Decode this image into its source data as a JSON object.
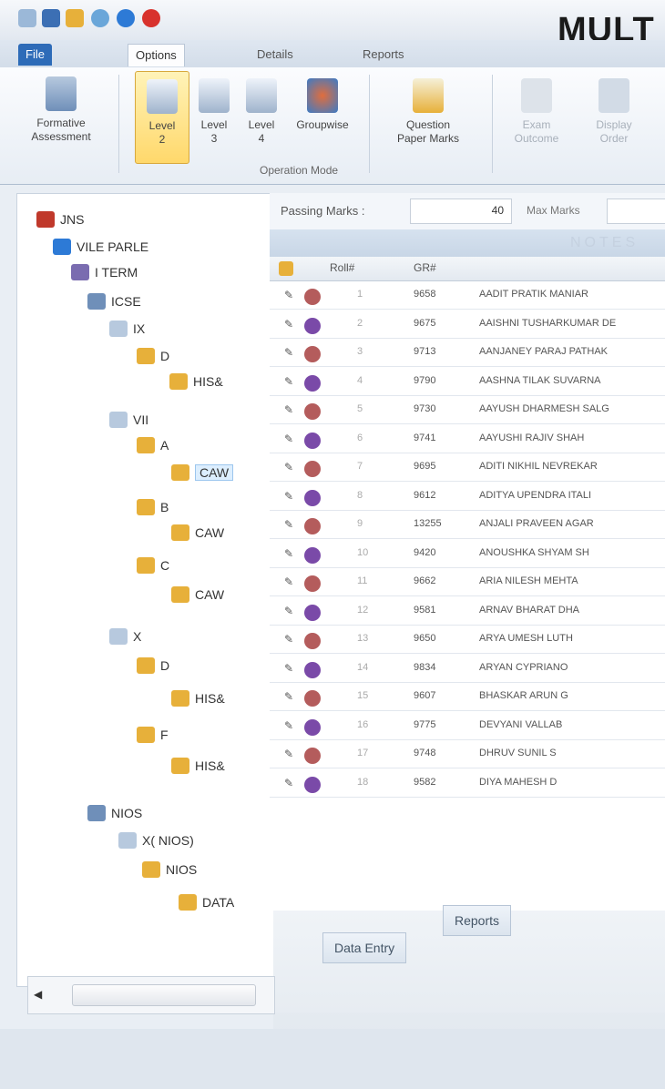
{
  "brand_heading": "MULT",
  "tabs": [
    "File",
    "Options",
    "Details",
    "Reports"
  ],
  "ribbon": {
    "formative": "Formative\nAssessment",
    "level2": "Level\n2",
    "level3": "Level\n3",
    "level4": "Level\n4",
    "groupwise": "Groupwise",
    "question_paper": "Question\nPaper Marks",
    "exam_outcome": "Exam\nOutcome",
    "display_order": "Display\nOrder",
    "group_label": "Operation Mode"
  },
  "tree": [
    {
      "label": "JNS"
    },
    {
      "label": "VILE PARLE"
    },
    {
      "label": "I TERM"
    },
    {
      "label": "ICSE"
    },
    {
      "label": "IX"
    },
    {
      "label": "D"
    },
    {
      "label": "HIS&"
    },
    {
      "label": "VII"
    },
    {
      "label": "A"
    },
    {
      "label": "CAW"
    },
    {
      "label": "B"
    },
    {
      "label": "CAW"
    },
    {
      "label": "C"
    },
    {
      "label": "CAW"
    },
    {
      "label": "X"
    },
    {
      "label": "D"
    },
    {
      "label": "HIS&"
    },
    {
      "label": "F"
    },
    {
      "label": "HIS&"
    },
    {
      "label": "NIOS"
    },
    {
      "label": "X( NIOS)"
    },
    {
      "label": "NIOS"
    },
    {
      "label": "DATA"
    }
  ],
  "passing": {
    "label": "Passing Marks :",
    "value": "40",
    "max_label": "Max Marks"
  },
  "note_text": "NOTES",
  "columns": [
    "Roll#",
    "GR#"
  ],
  "rows": [
    {
      "roll": "1",
      "gr": "9658",
      "name": "AADIT PRATIK MANIAR"
    },
    {
      "roll": "2",
      "gr": "9675",
      "name": "AAISHNI TUSHARKUMAR DE"
    },
    {
      "roll": "3",
      "gr": "9713",
      "name": "AANJANEY PARAJ PATHAK"
    },
    {
      "roll": "4",
      "gr": "9790",
      "name": "AASHNA TILAK SUVARNA"
    },
    {
      "roll": "5",
      "gr": "9730",
      "name": "AAYUSH DHARMESH SALG"
    },
    {
      "roll": "6",
      "gr": "9741",
      "name": "AAYUSHI RAJIV SHAH"
    },
    {
      "roll": "7",
      "gr": "9695",
      "name": "ADITI NIKHIL NEVREKAR"
    },
    {
      "roll": "8",
      "gr": "9612",
      "name": "ADITYA UPENDRA ITALI"
    },
    {
      "roll": "9",
      "gr": "13255",
      "name": "ANJALI PRAVEEN AGAR"
    },
    {
      "roll": "10",
      "gr": "9420",
      "name": "ANOUSHKA SHYAM SH"
    },
    {
      "roll": "11",
      "gr": "9662",
      "name": "ARIA NILESH MEHTA"
    },
    {
      "roll": "12",
      "gr": "9581",
      "name": "ARNAV BHARAT DHA"
    },
    {
      "roll": "13",
      "gr": "9650",
      "name": "ARYA UMESH LUTH"
    },
    {
      "roll": "14",
      "gr": "9834",
      "name": "ARYAN CYPRIANO"
    },
    {
      "roll": "15",
      "gr": "9607",
      "name": "BHASKAR ARUN G"
    },
    {
      "roll": "16",
      "gr": "9775",
      "name": "DEVYANI VALLAB"
    },
    {
      "roll": "17",
      "gr": "9748",
      "name": "DHRUV SUNIL S"
    },
    {
      "roll": "18",
      "gr": "9582",
      "name": "DIYA MAHESH D"
    }
  ],
  "bottom_tabs": [
    "Data Entry",
    "Reports"
  ],
  "colors": {
    "file_tab": "#2d6bb8",
    "selected_button": "#ffd86b",
    "brand": "#1a1a1a"
  }
}
